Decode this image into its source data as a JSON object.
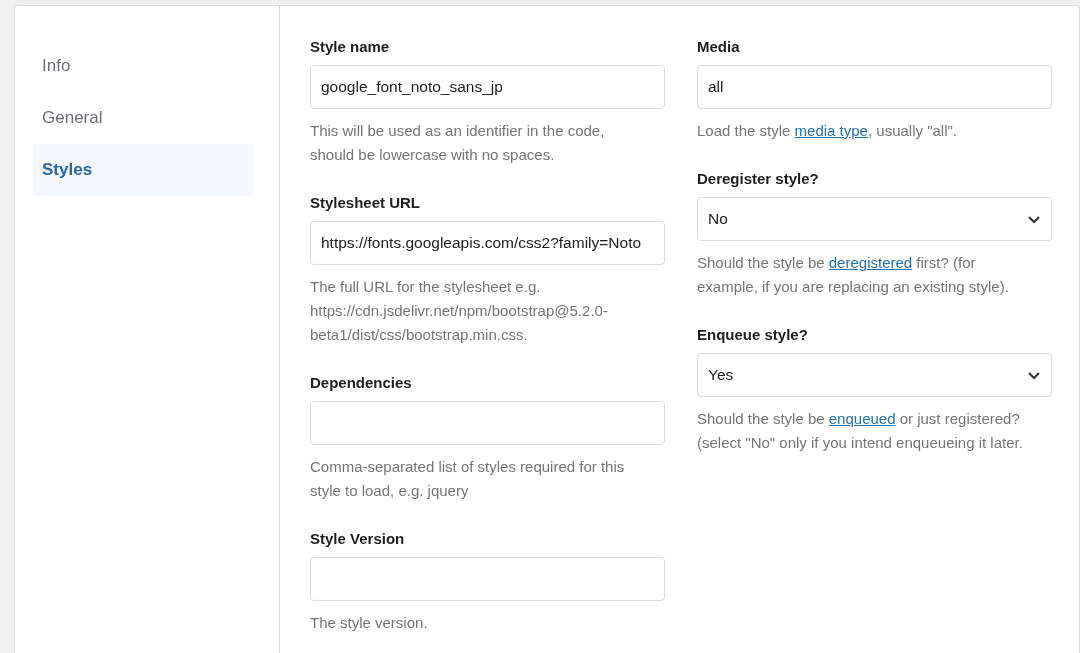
{
  "sidebar": {
    "items": [
      {
        "label": "Info",
        "selected": false
      },
      {
        "label": "General",
        "selected": false
      },
      {
        "label": "Styles",
        "selected": true
      }
    ]
  },
  "columns": [
    {
      "fields": [
        {
          "label": "Style name",
          "kind": "text",
          "value": "google_font_noto_sans_jp",
          "help": [
            {
              "text": "This will be used as an identifier in the code, should be lowercase with no spaces."
            }
          ]
        },
        {
          "label": "Stylesheet URL",
          "kind": "text",
          "value": "https://fonts.googleapis.com/css2?family=Noto",
          "help": [
            {
              "text": "The full URL for the stylesheet e.g. https://cdn.jsdelivr.net/npm/bootstrap@5.2.0-beta1/dist/css/bootstrap.min.css."
            }
          ]
        },
        {
          "label": "Dependencies",
          "kind": "text",
          "help": [
            {
              "text": "Comma-separated list of styles required for this style to load, e.g. jquery"
            }
          ]
        },
        {
          "label": "Style Version",
          "kind": "text",
          "help": [
            {
              "text": "The style version."
            }
          ]
        }
      ]
    },
    {
      "fields": [
        {
          "label": "Media",
          "kind": "text",
          "value": "all",
          "help": [
            {
              "text": "Load the style "
            },
            {
              "link": "media type"
            },
            {
              "text": ", usually \"all\"."
            }
          ]
        },
        {
          "label": "Deregister style?",
          "kind": "select",
          "value": "No",
          "help": [
            {
              "text": "Should the style be "
            },
            {
              "link": "deregistered"
            },
            {
              "text": " first? (for example, if you are replacing an existing style)."
            }
          ]
        },
        {
          "label": "Enqueue style?",
          "kind": "select",
          "value": "Yes",
          "help": [
            {
              "text": "Should the style be "
            },
            {
              "link": "enqueued"
            },
            {
              "text": " or just registered? (select \"No\" only if you intend enqueueing it later."
            }
          ]
        }
      ]
    }
  ]
}
